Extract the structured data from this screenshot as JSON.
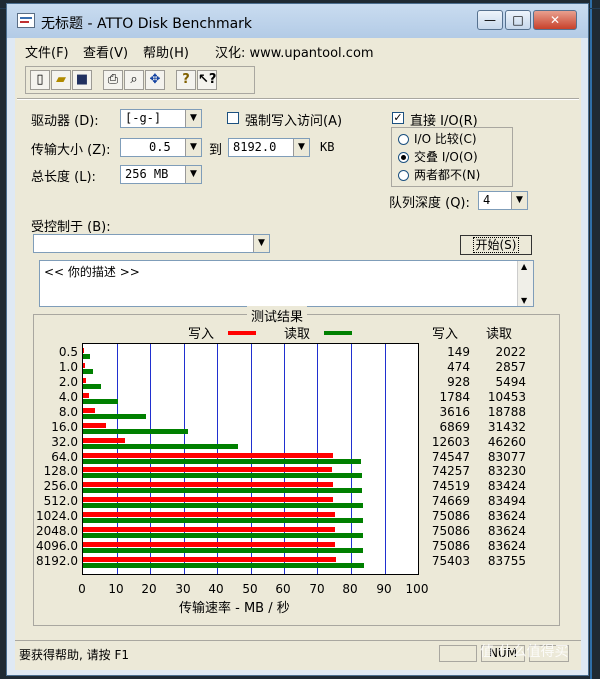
{
  "window": {
    "title": "无标题 - ATTO Disk Benchmark",
    "minimize": "—",
    "maximize": "□",
    "close": "✕"
  },
  "menu": {
    "file": "文件(F)",
    "view": "查看(V)",
    "help": "帮助(H)",
    "localized": "汉化: www.upantool.com"
  },
  "toolbar": {
    "new": "new-document-icon",
    "open": "open-folder-icon",
    "save": "save-disk-icon",
    "print": "printer-icon",
    "preview": "print-preview-icon",
    "move": "move-arrows-icon",
    "about": "about-question-icon",
    "context_help": "context-help-icon"
  },
  "settings": {
    "drive_label": "驱动器 (D):",
    "drive_value": "[-g-]",
    "force_write_label": "强制写入访问(A)",
    "force_write_checked": false,
    "direct_io_label": "直接 I/O(R)",
    "direct_io_checked": true,
    "transfer_label": "传输大小 (Z):",
    "transfer_min": "0.5",
    "to_label": "到",
    "transfer_max": "8192.0",
    "kb_label": "KB",
    "total_label": "总长度 (L):",
    "total_value": "256 MB",
    "io_compare": "I/O 比较(C)",
    "overlapped_io": "交叠 I/O(O)",
    "neither": "两者都不(N)",
    "selected_io": "交叠 I/O(O)",
    "queue_label": "队列深度 (Q):",
    "queue_value": "4",
    "controlled_by_label": "受控制于 (B):",
    "controlled_by_value": "",
    "start_button": "开始(S)",
    "description": "<<   你的描述     >>"
  },
  "results": {
    "title": "测试结果",
    "legend_write": "写入",
    "legend_read": "读取",
    "col_write": "写入",
    "col_read": "读取",
    "xaxis_label": "传输速率 - MB / 秒"
  },
  "status": {
    "help_text": "要获得帮助, 请按 F1",
    "num": "NUM"
  },
  "watermark": "值 什么值得买",
  "colors": {
    "write": "#ff0000",
    "read": "#008000",
    "grid": "#2030d0"
  },
  "chart_data": {
    "type": "bar",
    "orientation": "horizontal",
    "title": "测试结果",
    "xlabel": "传输速率 - MB / 秒",
    "xlim": [
      0,
      100
    ],
    "xticks": [
      0,
      10,
      20,
      30,
      40,
      50,
      60,
      70,
      80,
      90,
      100
    ],
    "categories": [
      "0.5",
      "1.0",
      "2.0",
      "4.0",
      "8.0",
      "16.0",
      "32.0",
      "64.0",
      "128.0",
      "256.0",
      "512.0",
      "1024.0",
      "2048.0",
      "4096.0",
      "8192.0"
    ],
    "series": [
      {
        "name": "写入",
        "color": "#ff0000",
        "values": [
          149,
          474,
          928,
          1784,
          3616,
          6869,
          12603,
          74547,
          74257,
          74519,
          74669,
          75086,
          75086,
          75086,
          75403
        ]
      },
      {
        "name": "读取",
        "color": "#008000",
        "values": [
          2022,
          2857,
          5494,
          10453,
          18788,
          31432,
          46260,
          83077,
          83230,
          83424,
          83494,
          83624,
          83624,
          83624,
          83755
        ]
      }
    ],
    "unit_note": "raw values in KB/s; bars plotted in MB/s"
  }
}
